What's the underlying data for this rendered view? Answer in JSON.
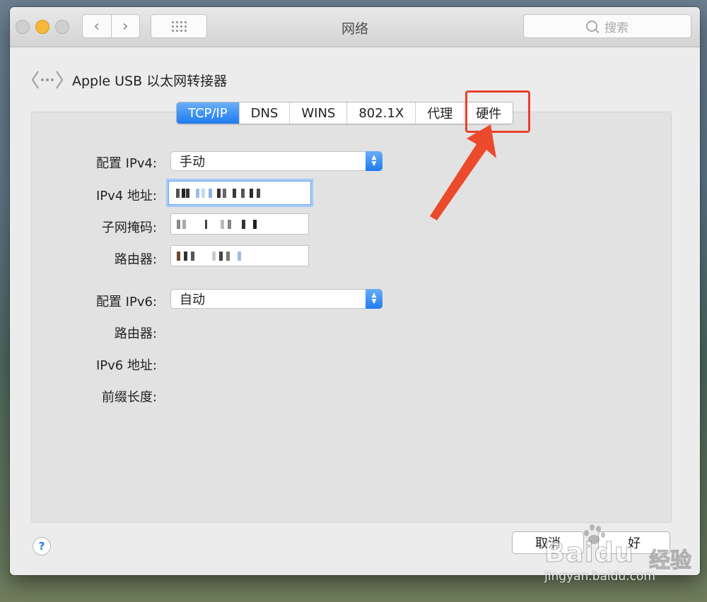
{
  "window": {
    "title": "网络",
    "search_placeholder": "搜索"
  },
  "interface": {
    "name": "Apple USB 以太网转接器",
    "icon": "ethernet-dots-icon"
  },
  "tabs": [
    {
      "label": "TCP/IP",
      "active": true
    },
    {
      "label": "DNS",
      "active": false
    },
    {
      "label": "WINS",
      "active": false
    },
    {
      "label": "802.1X",
      "active": false
    },
    {
      "label": "代理",
      "active": false
    },
    {
      "label": "硬件",
      "active": false
    }
  ],
  "ipv4": {
    "config_label": "配置 IPv4:",
    "config_value": "手动",
    "address_label": "IPv4 地址:",
    "subnet_label": "子网掩码:",
    "router_label": "路由器:"
  },
  "ipv6": {
    "config_label": "配置 IPv6:",
    "config_value": "自动",
    "router_label": "路由器:",
    "address_label": "IPv6 地址:",
    "prefix_label": "前缀长度:"
  },
  "buttons": {
    "help": "?",
    "cancel": "取消",
    "ok": "好"
  },
  "watermark": {
    "brand": "Baidu",
    "product": "经验",
    "url": "jingyan.baidu.com"
  },
  "colors": {
    "accent": "#1e7cf0",
    "highlight": "#e8412c"
  }
}
